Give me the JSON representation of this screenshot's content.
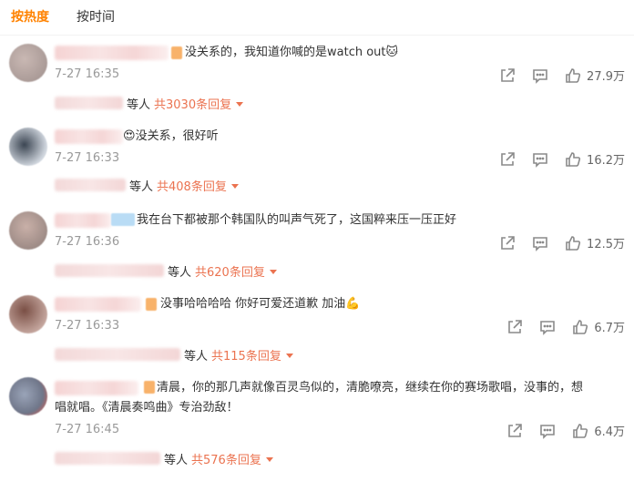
{
  "tabs": [
    {
      "label": "按热度"
    },
    {
      "label": "按时间"
    }
  ],
  "comments": [
    {
      "text": "没关系的，我知道你喊的是watch out",
      "emoji": "🐱",
      "time": "7-27 16:35",
      "likes": "27.9万",
      "sub_suffix": "等人",
      "reply_link": "共3030条回复"
    },
    {
      "text": "没关系，很好听",
      "emoji": "😍",
      "time": "7-27 16:33",
      "likes": "16.2万",
      "sub_suffix": "等人",
      "reply_link": "共408条回复"
    },
    {
      "text": "我在台下都被那个韩国队的叫声气死了，这国粹来压一压正好",
      "emoji": "",
      "time": "7-27 16:36",
      "likes": "12.5万",
      "sub_suffix": "等人",
      "reply_link": "共620条回复"
    },
    {
      "text": "没事哈哈哈哈 你好可爱还道歉 加油",
      "emoji": "💪",
      "time": "7-27 16:33",
      "likes": "6.7万",
      "sub_suffix": "等人",
      "reply_link": "共115条回复"
    },
    {
      "text": "清晨，你的那几声就像百灵鸟似的，清脆嘹亮，继续在你的赛场歌唱，没事的，想唱就唱。《清晨奏鸣曲》专治劲敌！",
      "emoji": "",
      "time": "7-27 16:45",
      "likes": "6.4万",
      "sub_suffix": "等人",
      "reply_link": "共576条回复"
    }
  ],
  "icons": {
    "share": "share-icon",
    "reply": "comment-icon",
    "like": "thumb-up-icon",
    "expand": "caret-down-icon"
  },
  "colors": {
    "accent": "#ff8200",
    "reply_link": "#eb7350",
    "muted": "#999999"
  }
}
